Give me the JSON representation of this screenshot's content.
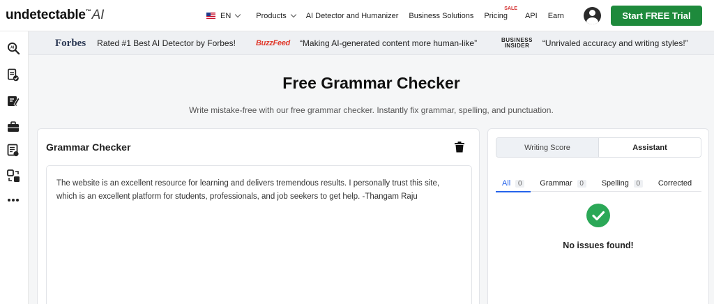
{
  "nav": {
    "logo": "undetectable",
    "logo_tm": "™",
    "logo_ai": "AI",
    "language": "EN",
    "products": "Products",
    "ai_detector": "AI Detector and Humanizer",
    "business": "Business Solutions",
    "pricing": "Pricing",
    "sale": "SALE",
    "api": "API",
    "earn": "Earn",
    "cta": "Start FREE Trial"
  },
  "sidebar": {
    "icons": [
      "ai-detector-icon",
      "document-check-icon",
      "edit-note-icon",
      "briefcase-icon",
      "report-icon",
      "transfer-icon",
      "more-icon"
    ]
  },
  "banner": {
    "forbes_logo": "Forbes",
    "forbes_text": "Rated #1 Best AI Detector by Forbes!",
    "buzzfeed_logo": "BuzzFeed",
    "buzzfeed_text": "“Making AI-generated content more human-like”",
    "bi_logo_line1": "BUSINESS",
    "bi_logo_line2": "INSIDER",
    "bi_text": "“Unrivaled accuracy and writing styles!”"
  },
  "main": {
    "title": "Free Grammar Checker",
    "subtitle": "Write mistake-free with our free grammar checker. Instantly fix grammar, spelling, and punctuation."
  },
  "checker": {
    "heading": "Grammar Checker",
    "text": "The website is an excellent resource for learning and delivers tremendous results. I personally trust this site, which is an excellent platform for students, professionals, and job seekers to get help. -Thangam Raju"
  },
  "results": {
    "seg_score": "Writing Score",
    "seg_assistant": "Assistant",
    "tab_all": "All",
    "tab_all_count": "0",
    "tab_grammar": "Grammar",
    "tab_grammar_count": "0",
    "tab_spelling": "Spelling",
    "tab_spelling_count": "0",
    "tab_corrected": "Corrected",
    "status": "No issues found!"
  },
  "colors": {
    "primary_green": "#1e8a3c",
    "accent_blue": "#2563eb",
    "check_green": "#2ba857"
  }
}
